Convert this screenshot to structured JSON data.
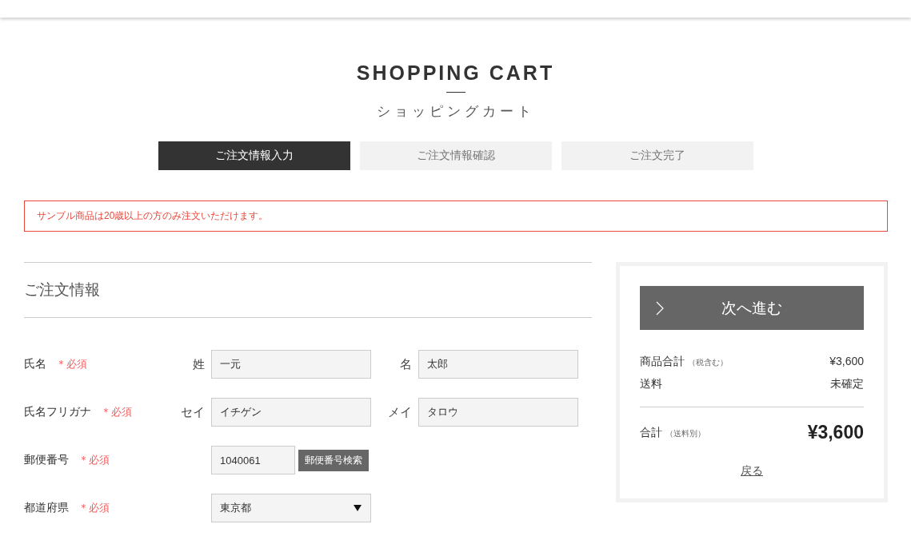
{
  "title": "SHOPPING CART",
  "subtitle": "ショッピングカート",
  "steps": [
    {
      "label": "ご注文情報入力",
      "selected": true
    },
    {
      "label": "ご注文情報確認",
      "selected": false
    },
    {
      "label": "ご注文完了",
      "selected": false
    }
  ],
  "notice": "サンプル商品は20歳以上の方のみ注文いただけます。",
  "section_title": "ご注文情報",
  "form": [
    {
      "kind": "pair",
      "label": "氏名",
      "required": "＊必須",
      "fields": [
        {
          "label": "姓",
          "value": "一元"
        },
        {
          "label": "名",
          "value": "太郎"
        }
      ]
    },
    {
      "kind": "pair",
      "label": "氏名フリガナ",
      "required": "＊必須",
      "fields": [
        {
          "label": "セイ",
          "value": "イチゲン"
        },
        {
          "label": "メイ",
          "value": "タロウ"
        }
      ]
    },
    {
      "kind": "postal",
      "label": "郵便番号",
      "required": "＊必須",
      "value": "1040061",
      "button": "郵便番号検索"
    },
    {
      "kind": "select",
      "label": "都道府県",
      "required": "＊必須",
      "value": "東京都"
    }
  ],
  "summary": {
    "next_button": "次へ進む",
    "lines": [
      {
        "label": "商品合計",
        "note": "（税含む）",
        "value": "¥3,600"
      },
      {
        "label": "送料",
        "value": "未確定"
      }
    ],
    "total": {
      "label": "合計",
      "note": "（送料別）",
      "value": "¥3,600"
    },
    "back_link": "戻る"
  }
}
